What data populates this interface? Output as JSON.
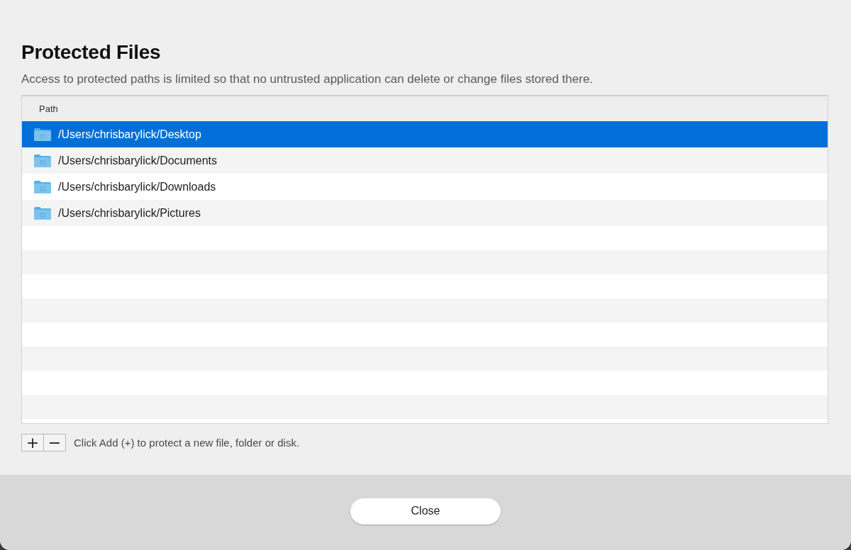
{
  "dialog": {
    "title": "Protected Files",
    "description": "Access to protected paths is limited so that no untrusted application can delete or change files stored there."
  },
  "table": {
    "columns": [
      "Path"
    ],
    "rows": [
      {
        "path": "/Users/chrisbarylick/Desktop",
        "selected": true
      },
      {
        "path": "/Users/chrisbarylick/Documents",
        "selected": false
      },
      {
        "path": "/Users/chrisbarylick/Downloads",
        "selected": false
      },
      {
        "path": "/Users/chrisbarylick/Pictures",
        "selected": false
      }
    ]
  },
  "toolbar": {
    "buttons": [
      "+",
      "−"
    ],
    "hint": "Click Add (+) to protect a new file, folder or disk."
  },
  "footer": {
    "buttons": [
      "Close"
    ]
  }
}
